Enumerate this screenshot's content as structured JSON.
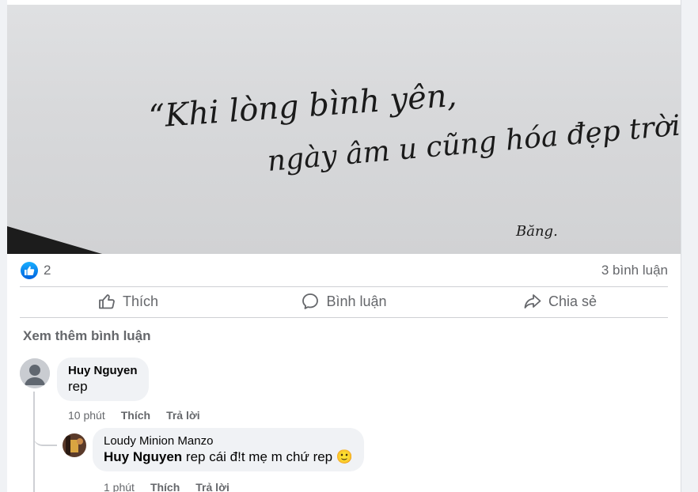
{
  "post": {
    "photo": {
      "handwriting_line1": "“Khi lòng bình yên,",
      "handwriting_line2": "ngày âm u cũng hóa đẹp trời.”",
      "signature": "Băng."
    },
    "reactions": {
      "count": "2",
      "icon": "like-icon",
      "color": "#1877f2"
    },
    "comment_count": "3 bình luận",
    "actions": {
      "like": "Thích",
      "comment": "Bình luận",
      "share": "Chia sẻ"
    },
    "see_more": "Xem thêm bình luận"
  },
  "comments": [
    {
      "author": "Huy Nguyen",
      "text": "rep",
      "time": "10 phút",
      "like": "Thích",
      "reply": "Trả lời",
      "reply_item": {
        "author": "Loudy Minion Manzo",
        "mention": "Huy Nguyen",
        "text": " rep cái đ!t mẹ m chứ rep",
        "emoji": "🙂",
        "time": "1 phút",
        "like": "Thích",
        "reply": "Trả lời"
      }
    }
  ]
}
